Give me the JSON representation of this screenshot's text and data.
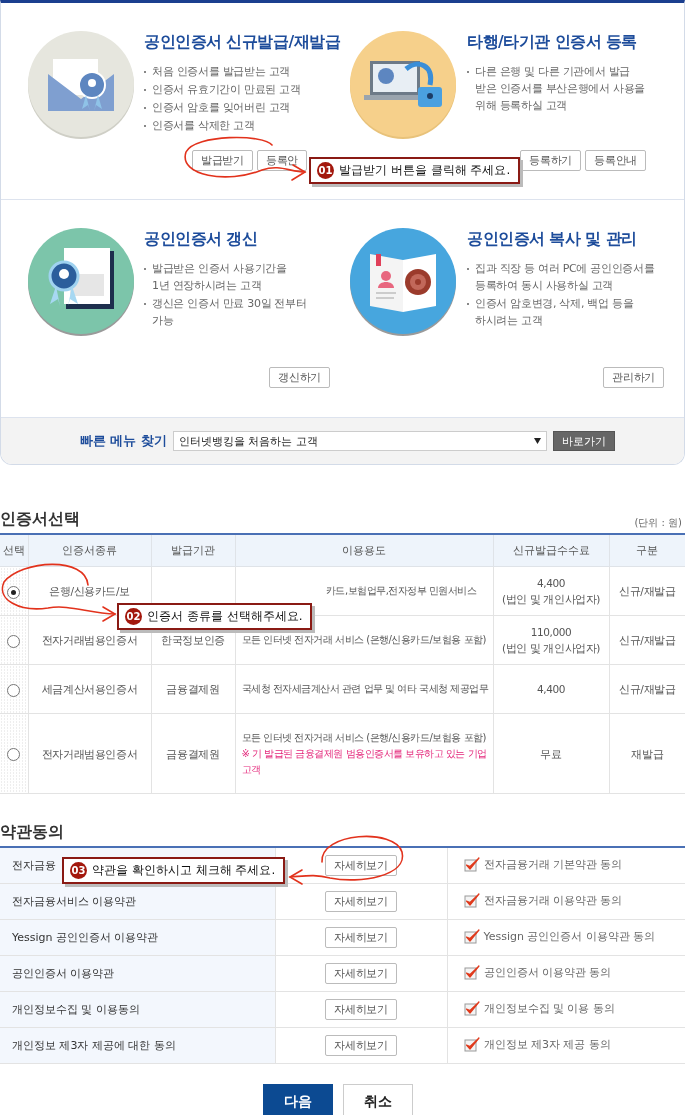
{
  "cards": [
    {
      "kind": "issue",
      "title": "공인인증서 신규발급/재발급",
      "bullets": [
        "처음 인증서를 발급받는 고객",
        "인증서 유효기간이 만료된 고객",
        "인증서 암호를 잊어버린 고객",
        "인증서를 삭제한 고객"
      ],
      "buttons": [
        "발급받기",
        "등록안"
      ]
    },
    {
      "kind": "register",
      "title": "타행/타기관 인증서 등록",
      "bullets": [
        "다른 은행 및 다른 기관에서 발급\n받은 인증서를 부산은행에서 사용을\n위해 등록하실 고객"
      ],
      "buttons": [
        "등록하기",
        "등록안내"
      ]
    },
    {
      "kind": "renew",
      "title": "공인인증서 갱신",
      "bullets": [
        "발급받은 인증서 사용기간을\n1년 연장하시려는 고객",
        "갱신은 인증서 만료 30일 전부터\n가능"
      ],
      "buttons": [
        "갱신하기"
      ]
    },
    {
      "kind": "manage",
      "title": "공인인증서 복사 및 관리",
      "bullets": [
        "집과 직장 등 여러 PC에 공인인증서를\n등록하여 동시 사용하실 고객",
        "인증서 암호변경, 삭제, 백업 등을\n하시려는 고객"
      ],
      "buttons": [
        "관리하기"
      ]
    }
  ],
  "quick_menu": {
    "label": "빠른 메뉴 찾기",
    "value": "인터넷뱅킹을 처음하는 고객",
    "button": "바로가기"
  },
  "certificates": {
    "title": "인증서선택",
    "unit": "(단위 : 원)",
    "columns": [
      "선택",
      "인증서종류",
      "발급기관",
      "이용용도",
      "신규발급수수료",
      "구분"
    ],
    "rows": [
      {
        "selected": true,
        "type": "은행/신용카드/보",
        "usage": "카드,보험업무,전자정부 민원서비스",
        "fee": "4,400",
        "fee_note": "(법인 및 개인사업자)",
        "category": "신규/재발급"
      },
      {
        "selected": false,
        "type": "전자거래범용인증서",
        "issuer": "한국정보인증",
        "usage": "모든 인터넷 전자거래 서비스 (은행/신용카드/보험용 포함)",
        "fee": "110,000",
        "fee_note": "(법인 및 개인사업자)",
        "category": "신규/재발급"
      },
      {
        "selected": false,
        "type": "세금계산서용인증서",
        "issuer": "금융결제원",
        "usage": "국세청 전자세금계산서 관련 업무 및 여타 국세청 제공업무",
        "fee": "4,400",
        "category": "신규/재발급"
      },
      {
        "selected": false,
        "type": "전자거래범용인증서",
        "issuer": "금융결제원",
        "usage": "모든 인터넷 전자거래 서비스 (은행/신용카드/보험용 포함)",
        "notice": "※ 기 발급된 금융결제원 범용인증서를 보유하고 있는 기업고객",
        "fee": "무료",
        "category": "재발급"
      }
    ]
  },
  "terms": {
    "title": "약관동의",
    "rows": [
      {
        "name": "전자금융",
        "button": "자세히보기",
        "agree": "전자금융거래 기본약관 동의",
        "checked": true
      },
      {
        "name": "전자금융서비스 이용약관",
        "button": "자세히보기",
        "agree": "전자금융거래 이용약관 동의",
        "checked": true
      },
      {
        "name": "Yessign 공인인증서 이용약관",
        "button": "자세히보기",
        "agree": "Yessign 공인인증서 이용약관 동의",
        "checked": true
      },
      {
        "name": "공인인증서 이용약관",
        "button": "자세히보기",
        "agree": "공인인증서 이용약관 동의",
        "checked": true
      },
      {
        "name": "개인정보수집 및 이용동의",
        "button": "자세히보기",
        "agree": "개인정보수집 및 이용 동의",
        "checked": true
      },
      {
        "name": "개인정보 제3자 제공에 대한 동의",
        "button": "자세히보기",
        "agree": "개인정보 제3자 제공 동의",
        "checked": true
      }
    ]
  },
  "actions": {
    "next": "다음",
    "cancel": "취소"
  },
  "callouts": [
    {
      "number": "01",
      "text": "발급받기 버튼을 클릭해 주세요."
    },
    {
      "number": "02",
      "text": "인증서 종류를 선택해주세요."
    },
    {
      "number": "03",
      "text": "약관을 확인하시고 체크해 주세요."
    }
  ]
}
